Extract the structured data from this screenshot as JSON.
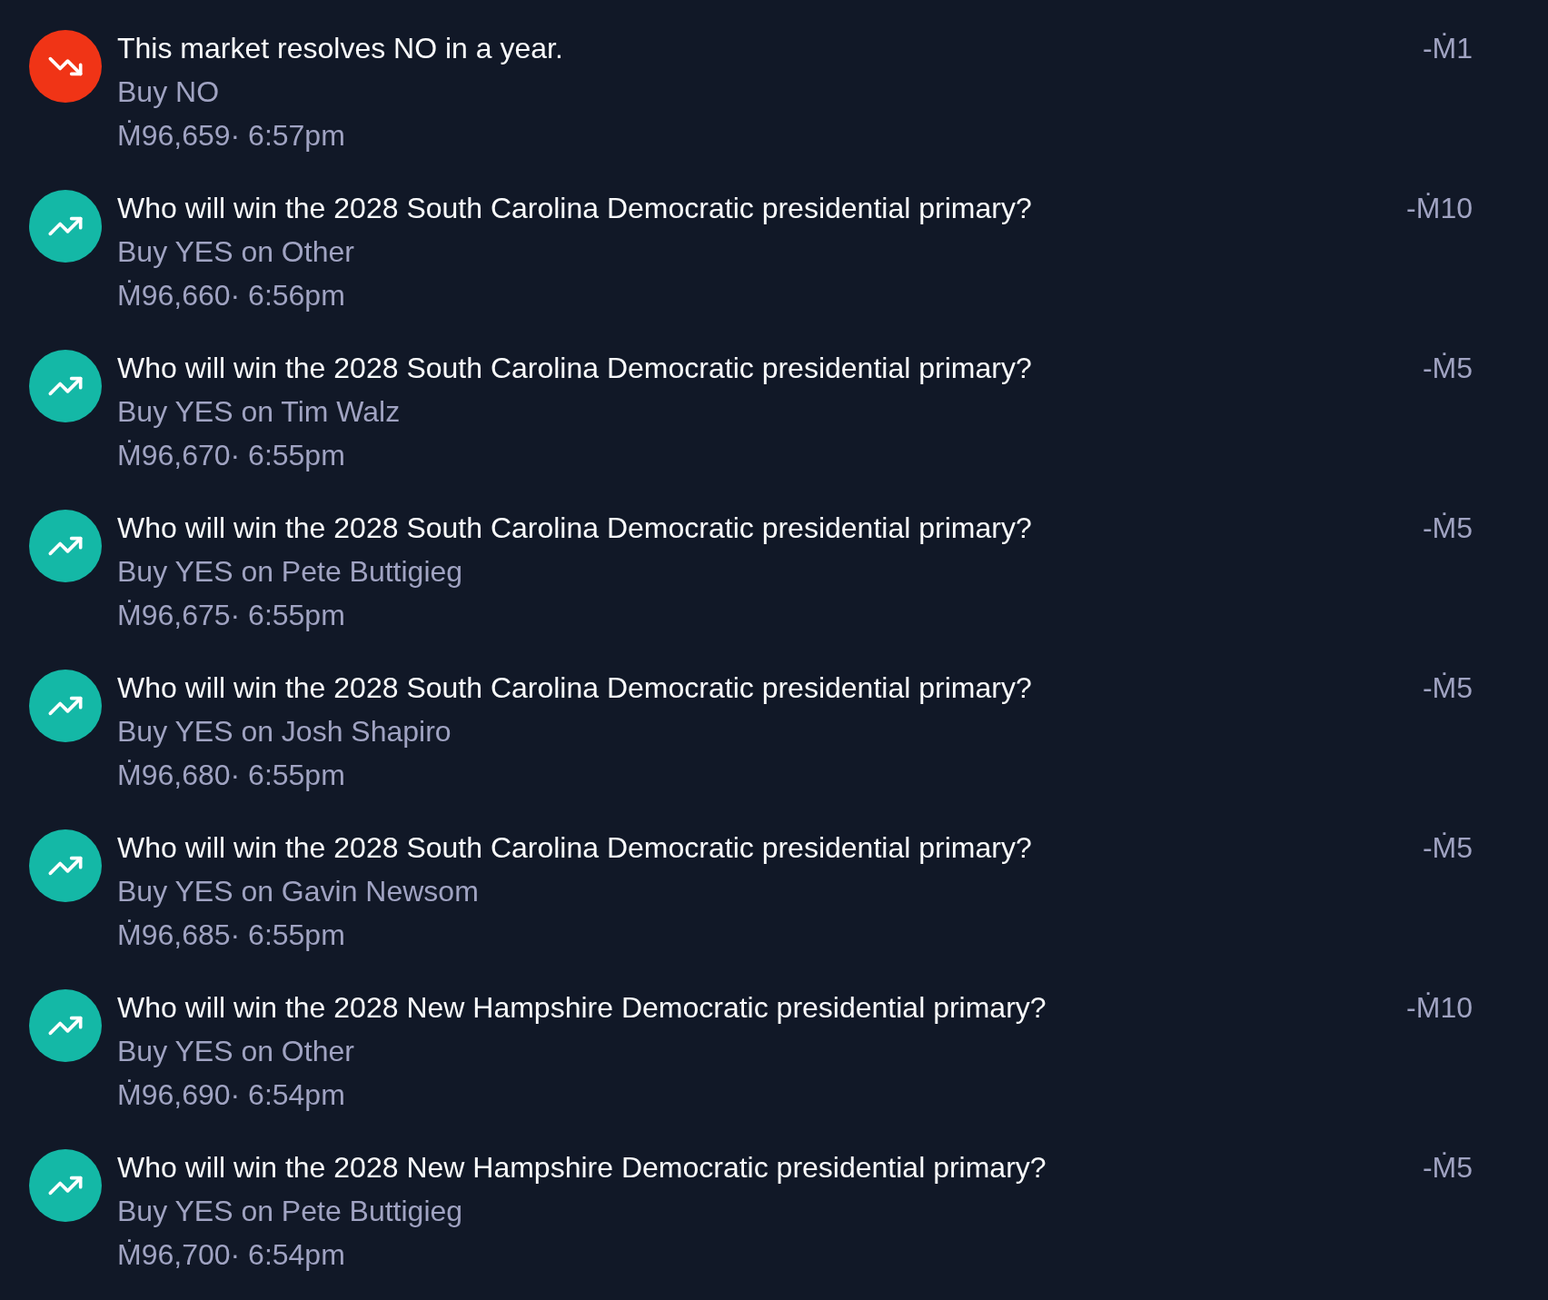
{
  "trades": [
    {
      "kind": "down",
      "title": "This market resolves NO in a year.",
      "description": "Buy NO",
      "meta": "Ṁ96,659· 6:57pm",
      "amount": "-Ṁ1"
    },
    {
      "kind": "up",
      "title": "Who will win the 2028 South Carolina Democratic presidential primary?",
      "description": "Buy YES on Other",
      "meta": "Ṁ96,660· 6:56pm",
      "amount": "-Ṁ10"
    },
    {
      "kind": "up",
      "title": "Who will win the 2028 South Carolina Democratic presidential primary?",
      "description": "Buy YES on Tim Walz",
      "meta": "Ṁ96,670· 6:55pm",
      "amount": "-Ṁ5"
    },
    {
      "kind": "up",
      "title": "Who will win the 2028 South Carolina Democratic presidential primary?",
      "description": "Buy YES on Pete Buttigieg",
      "meta": "Ṁ96,675· 6:55pm",
      "amount": "-Ṁ5"
    },
    {
      "kind": "up",
      "title": "Who will win the 2028 South Carolina Democratic presidential primary?",
      "description": "Buy YES on Josh Shapiro",
      "meta": "Ṁ96,680· 6:55pm",
      "amount": "-Ṁ5"
    },
    {
      "kind": "up",
      "title": "Who will win the 2028 South Carolina Democratic presidential primary?",
      "description": "Buy YES on Gavin Newsom",
      "meta": "Ṁ96,685· 6:55pm",
      "amount": "-Ṁ5"
    },
    {
      "kind": "up",
      "title": "Who will win the 2028 New Hampshire Democratic presidential primary?",
      "description": "Buy YES on Other",
      "meta": "Ṁ96,690· 6:54pm",
      "amount": "-Ṁ10"
    },
    {
      "kind": "up",
      "title": "Who will win the 2028 New Hampshire Democratic presidential primary?",
      "description": "Buy YES on Pete Buttigieg",
      "meta": "Ṁ96,700· 6:54pm",
      "amount": "-Ṁ5"
    }
  ]
}
